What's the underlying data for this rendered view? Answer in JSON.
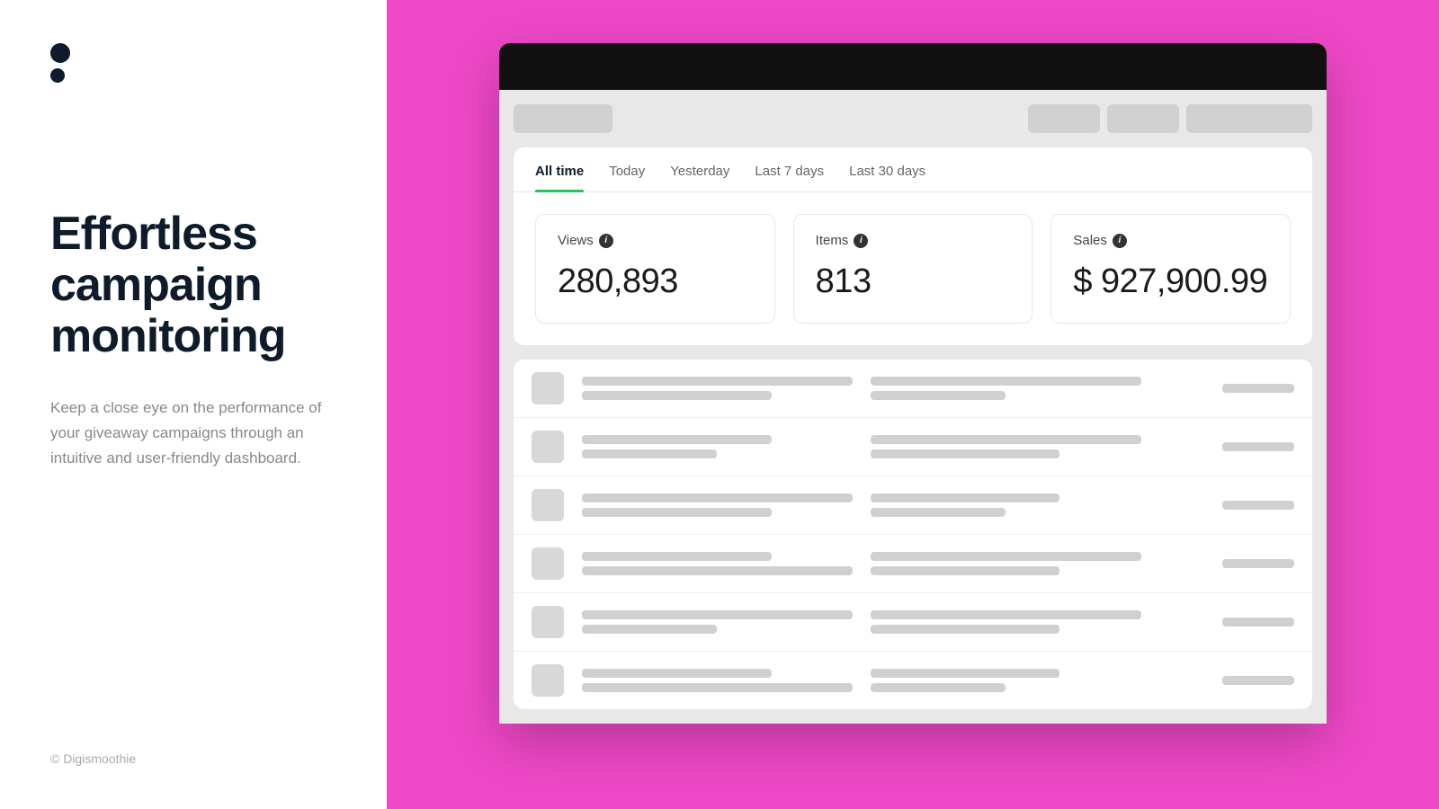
{
  "left": {
    "logo_label": "Digismoothie logo",
    "heading": "Effortless campaign monitoring",
    "description": "Keep a close eye on the performance of your giveaway campaigns through an intuitive and user-friendly dashboard.",
    "copyright": "© Digismoothie"
  },
  "dashboard": {
    "tabs": [
      {
        "id": "all-time",
        "label": "All time",
        "active": true
      },
      {
        "id": "today",
        "label": "Today",
        "active": false
      },
      {
        "id": "yesterday",
        "label": "Yesterday",
        "active": false
      },
      {
        "id": "last-7",
        "label": "Last 7 days",
        "active": false
      },
      {
        "id": "last-30",
        "label": "Last 30 days",
        "active": false
      }
    ],
    "metrics": [
      {
        "id": "views",
        "label": "Views",
        "value": "280,893"
      },
      {
        "id": "items",
        "label": "Items",
        "value": "813"
      },
      {
        "id": "sales",
        "label": "Sales",
        "value": "$ 927,900.99"
      }
    ],
    "header_buttons": [
      {
        "id": "btn1",
        "label": "",
        "size": "wide"
      },
      {
        "id": "btn2",
        "label": "",
        "size": "med"
      },
      {
        "id": "btn3",
        "label": "",
        "size": "lg"
      }
    ],
    "table_rows": [
      {
        "id": "row1"
      },
      {
        "id": "row2"
      },
      {
        "id": "row3"
      },
      {
        "id": "row4"
      },
      {
        "id": "row5"
      },
      {
        "id": "row6"
      }
    ]
  }
}
